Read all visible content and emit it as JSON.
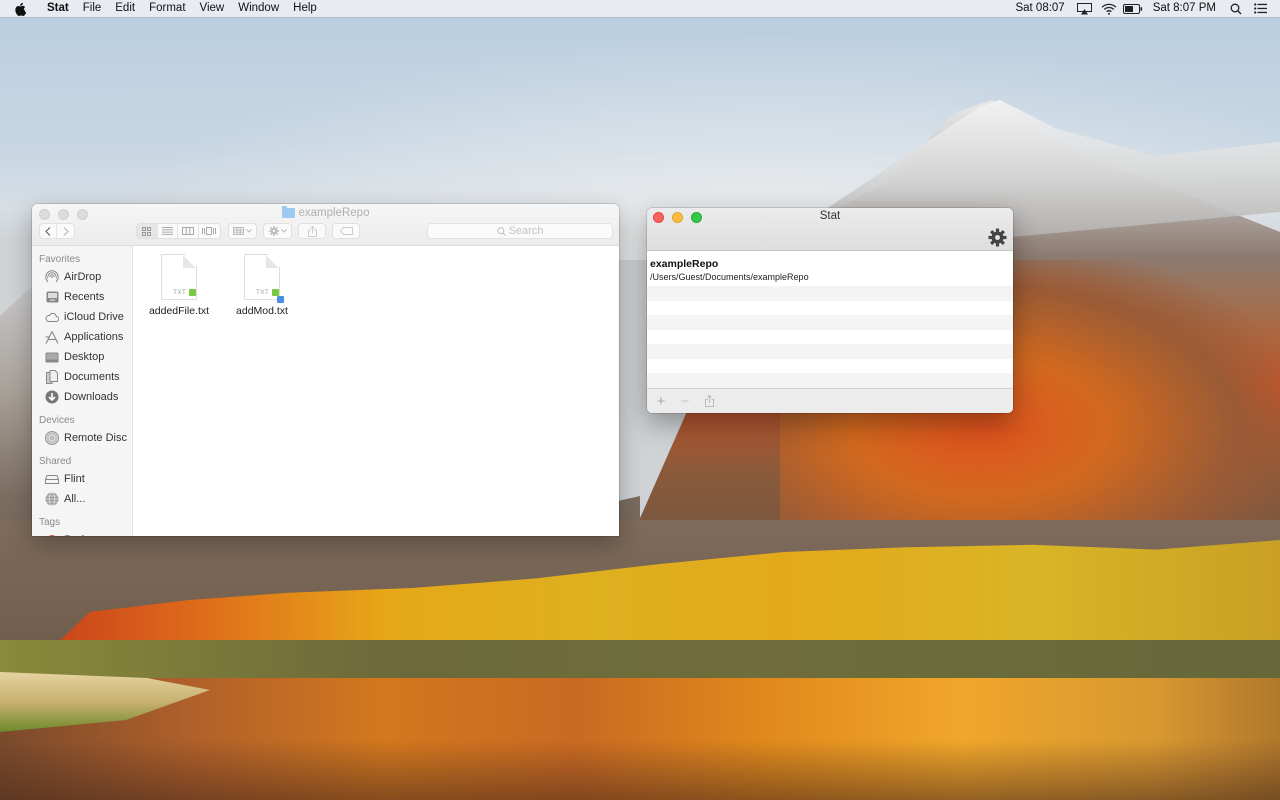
{
  "menubar": {
    "apple_icon": "apple-logo-icon",
    "app_name": "Stat",
    "menus": [
      "File",
      "Edit",
      "Format",
      "View",
      "Window",
      "Help"
    ],
    "status": {
      "clock_24": "Sat 08:07",
      "airplay_icon": "airplay-icon",
      "wifi_icon": "wifi-icon",
      "battery_icon": "battery-icon",
      "clock": "Sat 8:07 PM",
      "spotlight_icon": "search-icon",
      "notification_icon": "list-icon"
    }
  },
  "finder": {
    "title": "exampleRepo",
    "toolbar": {
      "back_icon": "chevron-left-icon",
      "forward_icon": "chevron-right-icon",
      "view_modes": [
        "icon-view",
        "list-view",
        "column-view",
        "cover-flow-view"
      ],
      "arrange_icon": "arrange-grid-icon",
      "action_icon": "gear-icon",
      "share_icon": "share-icon",
      "tags_icon": "tag-icon",
      "search_placeholder": "Search"
    },
    "sidebar": {
      "sections": [
        {
          "title": "Favorites",
          "items": [
            {
              "label": "AirDrop",
              "icon": "airdrop-icon"
            },
            {
              "label": "Recents",
              "icon": "recents-icon"
            },
            {
              "label": "iCloud Drive",
              "icon": "cloud-icon"
            },
            {
              "label": "Applications",
              "icon": "applications-icon"
            },
            {
              "label": "Desktop",
              "icon": "desktop-icon"
            },
            {
              "label": "Documents",
              "icon": "documents-icon"
            },
            {
              "label": "Downloads",
              "icon": "download-icon"
            }
          ]
        },
        {
          "title": "Devices",
          "items": [
            {
              "label": "Remote Disc",
              "icon": "disc-icon"
            }
          ]
        },
        {
          "title": "Shared",
          "items": [
            {
              "label": "Flint",
              "icon": "server-icon"
            },
            {
              "label": "All...",
              "icon": "network-globe-icon"
            }
          ]
        },
        {
          "title": "Tags",
          "items": [
            {
              "label": "Red",
              "icon": "tag-dot-icon",
              "color": "#f0443a"
            }
          ]
        }
      ]
    },
    "files": [
      {
        "name": "addedFile.txt",
        "type": "TXT",
        "tags": [
          "#7ac943"
        ]
      },
      {
        "name": "addMod.txt",
        "type": "TXT",
        "tags": [
          "#7ac943",
          "#4a90e2"
        ]
      }
    ]
  },
  "stat": {
    "title": "Stat",
    "settings_icon": "gear-icon",
    "repos": [
      {
        "name": "exampleRepo",
        "path": "/Users/Guest/Documents/exampleRepo"
      }
    ],
    "footer": {
      "add_label": "+",
      "remove_label": "−",
      "share_icon": "share-icon"
    }
  }
}
